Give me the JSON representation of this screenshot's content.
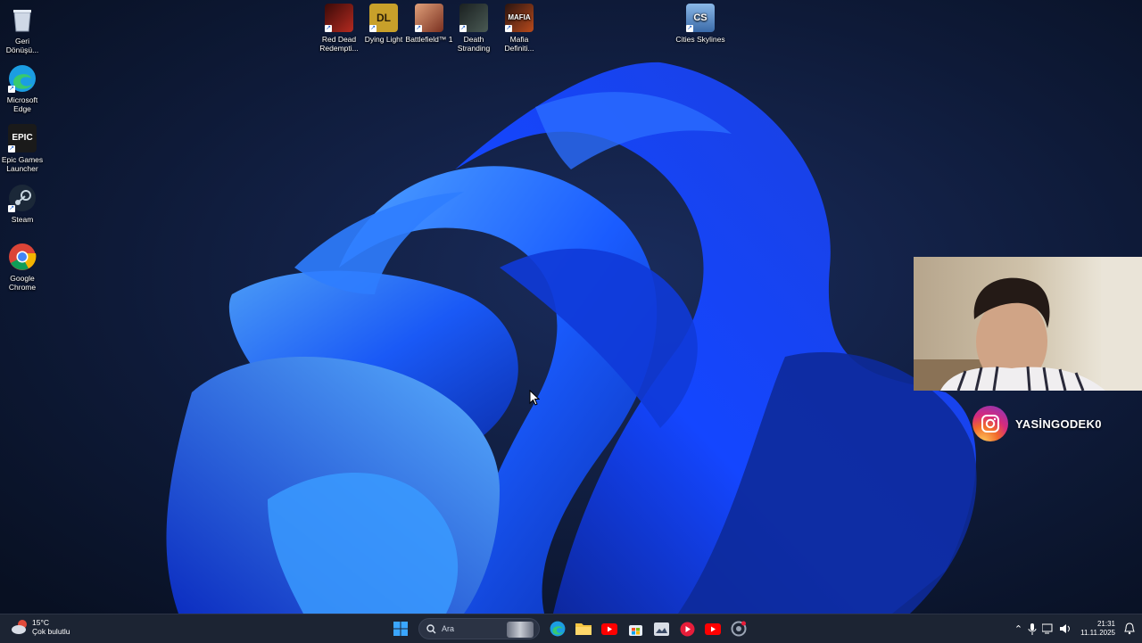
{
  "desktop": {
    "left_icons": [
      {
        "label": "Geri Dönüşü...",
        "icon": "recycle-bin-icon"
      },
      {
        "label": "Microsoft Edge",
        "icon": "edge-icon"
      },
      {
        "label": "Epic Games Launcher",
        "icon": "epic-games-icon",
        "glyph": "EPIC"
      },
      {
        "label": "Steam",
        "icon": "steam-icon"
      },
      {
        "label": "Google Chrome",
        "icon": "chrome-icon"
      }
    ],
    "top_icons": [
      {
        "label": "Red Dead Redempti...",
        "icon": "red-dead-icon",
        "color": "#8a1a16"
      },
      {
        "label": "Dying Light",
        "icon": "dying-light-icon",
        "color": "#c8a02a",
        "glyph": "DL"
      },
      {
        "label": "Battlefield™ 1",
        "icon": "battlefield-icon",
        "color": "#b05a3a"
      },
      {
        "label": "Death Stranding",
        "icon": "death-stranding-icon",
        "color": "#2e3a3a"
      },
      {
        "label": "Mafia Definiti...",
        "icon": "mafia-icon",
        "color": "#7a2a14",
        "glyph": "MAFIA"
      },
      {
        "label": "Cities Skylines",
        "icon": "cities-skylines-icon",
        "color": "#4a7ab8",
        "glyph": "CS"
      }
    ]
  },
  "overlay": {
    "instagram_handle": "YASİNGODEK0"
  },
  "taskbar": {
    "weather": {
      "temp": "15°C",
      "desc": "Çok bulutlu"
    },
    "search_placeholder": "Ara",
    "apps": [
      "edge-icon",
      "file-explorer-icon",
      "youtube-icon",
      "microsoft-store-icon",
      "photos-icon",
      "media-player-icon",
      "youtube-icon",
      "chrome-dev-icon"
    ],
    "time": "21:31",
    "date": "11.11.2025"
  },
  "colors": {
    "accent": "#1e5bff",
    "taskbar": "#1c2433"
  }
}
